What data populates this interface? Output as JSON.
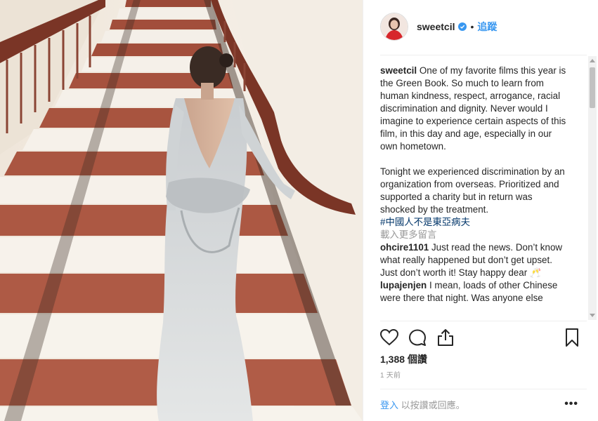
{
  "post": {
    "username": "sweetcil",
    "dot": "•",
    "follow_label": "追蹤"
  },
  "caption": {
    "username": "sweetcil",
    "paragraph1": "One of my favorite films this year is the Green Book. So much to learn from human kindness, respect, arrogance, racial discrimination and dignity. Never would I imagine to experience certain aspects of this film, in this day and age, especially in our own hometown.",
    "paragraph2": "Tonight we experienced discrimination by an organization from overseas. Prioritized and supported a charity but in return was shocked by the treatment.",
    "hashtag": "#中國人不是東亞病夫"
  },
  "load_more_label": "載入更多留言",
  "comments": [
    {
      "username": "ohcire1101",
      "text": "Just read the news. Don’t know what really happened but don’t get upset. Just don’t worth it! Stay happy dear 🥂"
    },
    {
      "username": "lupajenjen",
      "text": "I mean, loads of other Chinese were there that night. Was anyone else"
    }
  ],
  "likes": "1,388 個讚",
  "timestamp": "1 天前",
  "footer": {
    "login_link": "登入",
    "login_rest": "以按讚或回應。",
    "more_label": "•••"
  },
  "icons": {
    "verified": "verified-badge-icon",
    "like": "heart-icon",
    "comment": "comment-bubble-icon",
    "share": "share-icon",
    "save": "bookmark-icon"
  },
  "colors": {
    "link": "#3897f0",
    "hashtag": "#003569",
    "muted": "#999999"
  }
}
